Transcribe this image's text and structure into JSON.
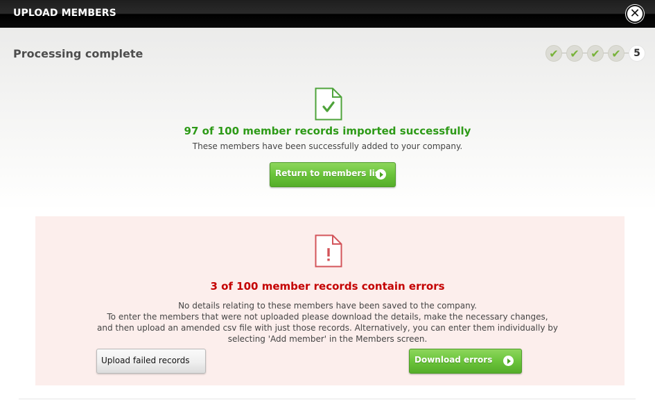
{
  "window": {
    "title": "UPLOAD MEMBERS",
    "close_icon": "close-icon"
  },
  "header": {
    "title": "Processing complete"
  },
  "steps": {
    "items": [
      {
        "label": "✔",
        "status": "complete"
      },
      {
        "label": "✔",
        "status": "complete"
      },
      {
        "label": "✔",
        "status": "complete"
      },
      {
        "label": "✔",
        "status": "complete"
      },
      {
        "label": "5",
        "status": "current"
      }
    ]
  },
  "success": {
    "icon": "document-check-icon",
    "title": "97 of 100 member records imported successfully",
    "subtitle": "These members have been successfully added to your company.",
    "button_label": "Return to members list",
    "color": "#2d9a17"
  },
  "errors": {
    "icon": "document-warning-icon",
    "title": "3 of 100 member records contain errors",
    "lines": [
      "No details relating to these members have been saved to the company.",
      "To enter the members that were not uploaded please download the details, make the necessary changes,",
      "and then upload an amended csv file with just those records. Alternatively, you can enter them individually by",
      "selecting 'Add member' in the Members screen."
    ],
    "upload_button_label": "Upload failed records",
    "download_button_label": "Download errors",
    "color": "#c40000",
    "panel_color": "#fceeec"
  }
}
